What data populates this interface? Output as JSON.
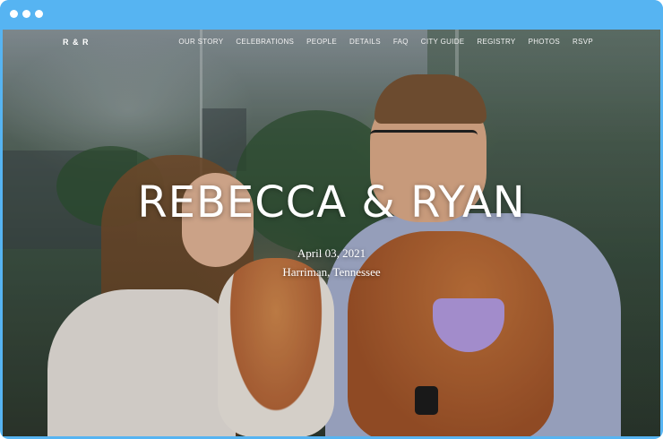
{
  "browser": {
    "controls": [
      "dot-1",
      "dot-2",
      "dot-3"
    ]
  },
  "site": {
    "brand": "R & R",
    "nav": [
      "OUR STORY",
      "CELEBRATIONS",
      "PEOPLE",
      "DETAILS",
      "FAQ",
      "CITY GUIDE",
      "REGISTRY",
      "PHOTOS",
      "RSVP"
    ]
  },
  "hero": {
    "title": "REBECCA & RYAN",
    "date": "April 03, 2021",
    "location": "Harriman, Tennessee",
    "background_image": "couple-with-dogs-photo"
  },
  "colors": {
    "browser_chrome": "#56b4f2",
    "text": "#ffffff"
  }
}
